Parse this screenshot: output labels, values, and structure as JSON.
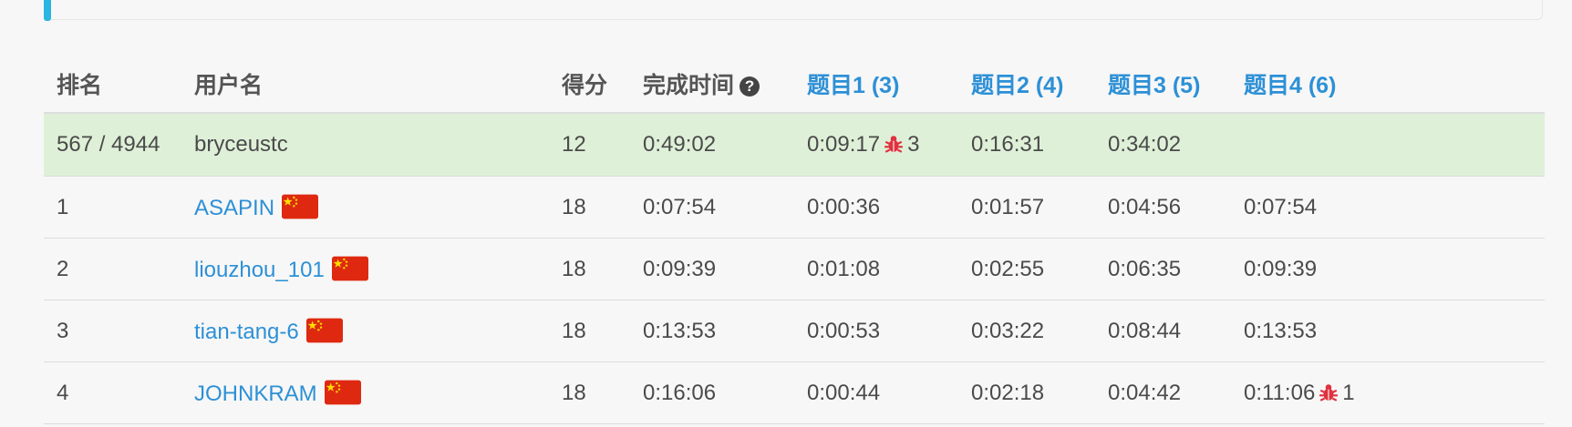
{
  "header": {
    "rank": "排名",
    "username": "用户名",
    "score": "得分",
    "finish_time": "完成时间",
    "q1": "题目1 (3)",
    "q2": "题目2 (4)",
    "q3": "题目3 (5)",
    "q4": "题目4 (6)"
  },
  "me": {
    "rank": "567 / 4944",
    "username": "bryceustc",
    "score": "12",
    "finish_time": "0:49:02",
    "q1": "0:09:17",
    "q1_wrong": "3",
    "q2": "0:16:31",
    "q3": "0:34:02",
    "q4": ""
  },
  "rows": [
    {
      "rank": "1",
      "username": "ASAPIN",
      "score": "18",
      "finish_time": "0:07:54",
      "q1": "0:00:36",
      "q2": "0:01:57",
      "q3": "0:04:56",
      "q4": "0:07:54",
      "q4_wrong": ""
    },
    {
      "rank": "2",
      "username": "liouzhou_101",
      "score": "18",
      "finish_time": "0:09:39",
      "q1": "0:01:08",
      "q2": "0:02:55",
      "q3": "0:06:35",
      "q4": "0:09:39",
      "q4_wrong": ""
    },
    {
      "rank": "3",
      "username": "tian-tang-6",
      "score": "18",
      "finish_time": "0:13:53",
      "q1": "0:00:53",
      "q2": "0:03:22",
      "q3": "0:08:44",
      "q4": "0:13:53",
      "q4_wrong": ""
    },
    {
      "rank": "4",
      "username": "JOHNKRAM",
      "score": "18",
      "finish_time": "0:16:06",
      "q1": "0:00:44",
      "q2": "0:02:18",
      "q3": "0:04:42",
      "q4": "0:11:06",
      "q4_wrong": "1"
    }
  ],
  "icons": {
    "help": "question-circle-icon",
    "bug": "bug-icon",
    "flag": "china-flag-icon"
  },
  "colors": {
    "link": "#2d90d6",
    "highlight_row": "#dff0d8",
    "bug": "#e0313f",
    "accent": "#2bb5e0"
  }
}
